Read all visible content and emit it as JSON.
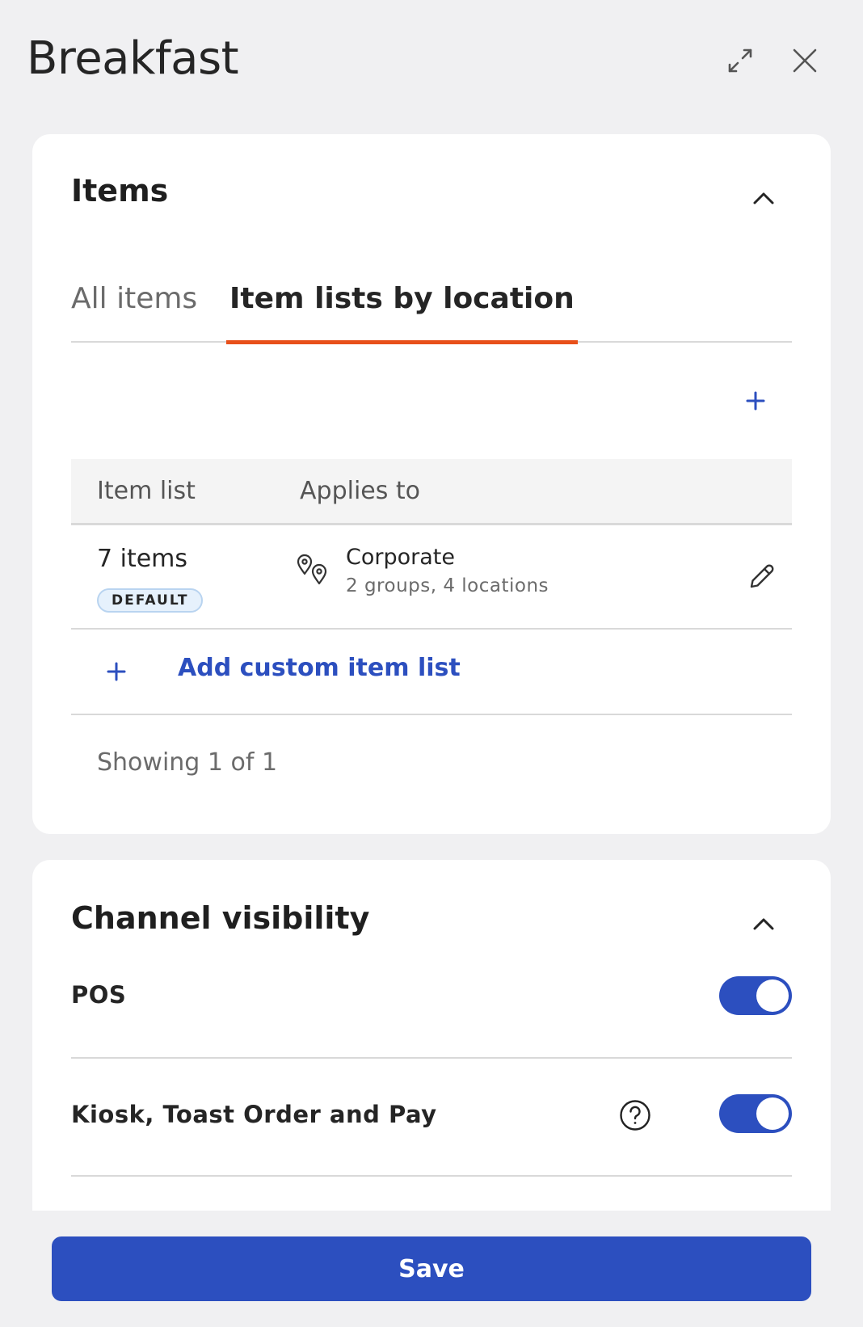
{
  "header": {
    "title": "Breakfast",
    "expand_icon": "expand-arrows-icon",
    "close_icon": "close-x-icon"
  },
  "items_section": {
    "title": "Items",
    "tabs": [
      {
        "label": "All items",
        "selected": false
      },
      {
        "label": "Item lists by location",
        "selected": true
      }
    ],
    "table": {
      "columns": [
        "Item list",
        "Applies to"
      ],
      "rows": [
        {
          "item_count": "7 items",
          "badge": "DEFAULT",
          "location_name": "Corporate",
          "location_detail": "2 groups, 4 locations"
        }
      ]
    },
    "add_custom_label": "Add custom item list",
    "showing": "Showing 1 of 1"
  },
  "channel_section": {
    "title": "Channel visibility",
    "channels": [
      {
        "label": "POS",
        "enabled": true
      },
      {
        "label": "Kiosk, Toast Order and Pay",
        "enabled": true
      }
    ]
  },
  "footer": {
    "save_label": "Save"
  },
  "colors": {
    "primary": "#2c4fbf",
    "tab_active_underline": "#e8501a",
    "badge_bg": "#e6f1fc",
    "page_bg": "#f0f0f2"
  }
}
